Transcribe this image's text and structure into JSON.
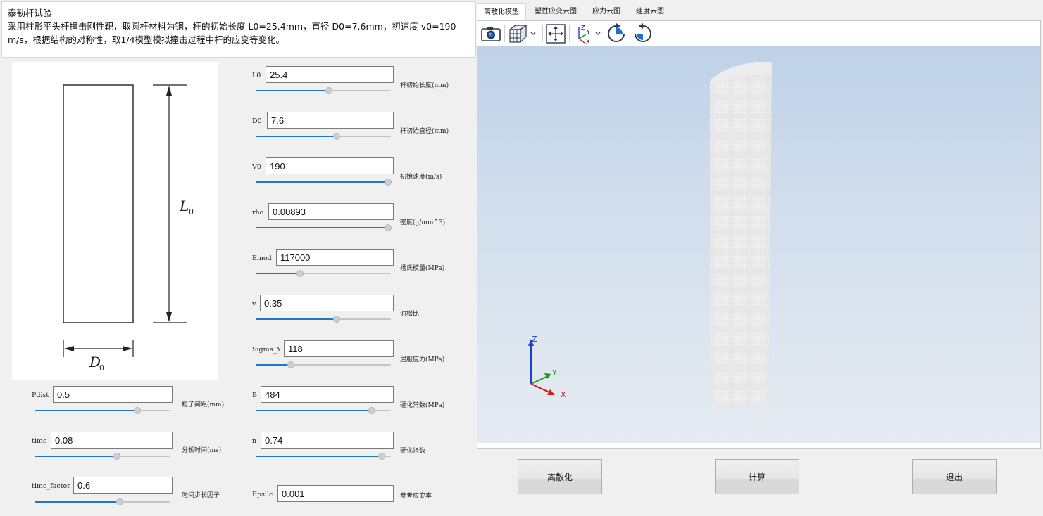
{
  "description": {
    "title": "泰勒杆试验",
    "body": "采用柱形平头杆撞击刚性靶，取圆杆材料为铜，杆的初始长度 L0=25.4mm，直径 D0=7.6mm，初速度 v0=190 m/s，根据结构的对称性，取1/4模型模拟撞击过程中杆的应变等变化。"
  },
  "schematic": {
    "length_label": "L",
    "length_sub": "0",
    "diameter_label": "D",
    "diameter_sub": "0"
  },
  "left_params": [
    {
      "label": "Pdist",
      "value": "0.5",
      "desc": "粒子间距(mm)",
      "level": 0.76
    },
    {
      "label": "time",
      "value": "0.08",
      "desc": "分析时间(ms)",
      "level": 0.61
    },
    {
      "label": "time_factor",
      "value": "0.6",
      "desc": "时间步长因子",
      "level": 0.63
    }
  ],
  "right_params": [
    {
      "label": "L0",
      "value": "25.4",
      "desc": "杆初始长度(mm)",
      "level": 0.54
    },
    {
      "label": "D0",
      "value": "7.6",
      "desc": "杆初始直径(mm)",
      "level": 0.6
    },
    {
      "label": "V0",
      "value": "190",
      "desc": "初始速度(m/s)",
      "level": 0.98
    },
    {
      "label": "rho",
      "value": "0.00893",
      "desc": "密度(g/mm^3)",
      "level": 0.98
    },
    {
      "label": "Emod",
      "value": "117000",
      "desc": "杨氏模量(MPa)",
      "level": 0.33
    },
    {
      "label": "v",
      "value": "0.35",
      "desc": "泊松比",
      "level": 0.6
    },
    {
      "label": "Sigma_Y",
      "value": "118",
      "desc": "屈服应力(MPa)",
      "level": 0.26
    },
    {
      "label": "B",
      "value": "484",
      "desc": "硬化常数(MPa)",
      "level": 0.86
    },
    {
      "label": "n",
      "value": "0.74",
      "desc": "硬化指数",
      "level": 0.93
    },
    {
      "label": "Epsilc",
      "value": "0.001",
      "desc": "参考应变率"
    }
  ],
  "tabs": [
    {
      "label": "离散化模型",
      "active": true
    },
    {
      "label": "塑性应变云图",
      "active": false
    },
    {
      "label": "应力云图",
      "active": false
    },
    {
      "label": "速度云图",
      "active": false
    }
  ],
  "toolbar": [
    "camera-icon",
    "view-cube-icon",
    "fit-view-icon",
    "axes-orientation-icon",
    "rotate-cw-icon",
    "rotate-ccw-icon"
  ],
  "axes": {
    "z": "Z",
    "y": "Y",
    "x": "X",
    "z_color": "#1f3fd0",
    "y_color": "#1a9a1a",
    "x_color": "#d01818"
  },
  "buttons": {
    "discretize": "离散化",
    "compute": "计算",
    "exit": "退出"
  }
}
